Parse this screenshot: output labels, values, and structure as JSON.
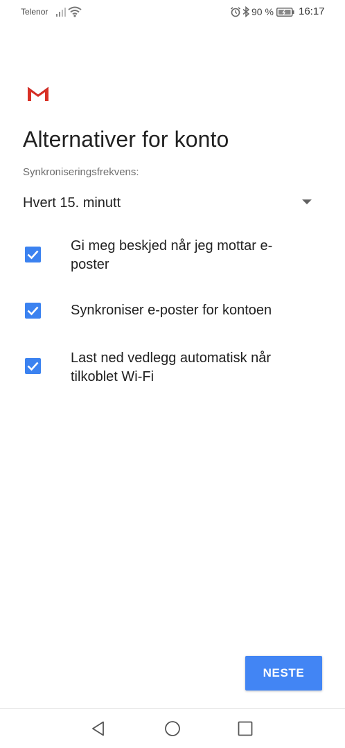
{
  "status_bar": {
    "carrier": "Telenor",
    "battery_percent": "90 %",
    "time": "16:17",
    "icons": [
      "signal-icon",
      "wifi-icon",
      "alarm-icon",
      "bluetooth-icon",
      "battery-icon"
    ]
  },
  "app": {
    "logo": "gmail-logo"
  },
  "page": {
    "title": "Alternativer for konto",
    "sync_label": "Synkroniseringsfrekvens:",
    "sync_value": "Hvert 15. minutt"
  },
  "options": [
    {
      "label": "Gi meg beskjed når jeg mottar e-poster",
      "checked": true
    },
    {
      "label": "Synkroniser e-poster for kontoen",
      "checked": true
    },
    {
      "label": "Last ned vedlegg automatisk når tilkoblet Wi-Fi",
      "checked": true
    }
  ],
  "actions": {
    "next_label": "NESTE"
  },
  "colors": {
    "accent": "#4285f4",
    "checkbox": "#3b82f0",
    "gmail_red": "#d93025"
  },
  "nav_bar": {
    "icons": [
      "back-icon",
      "home-icon",
      "recent-apps-icon"
    ]
  }
}
